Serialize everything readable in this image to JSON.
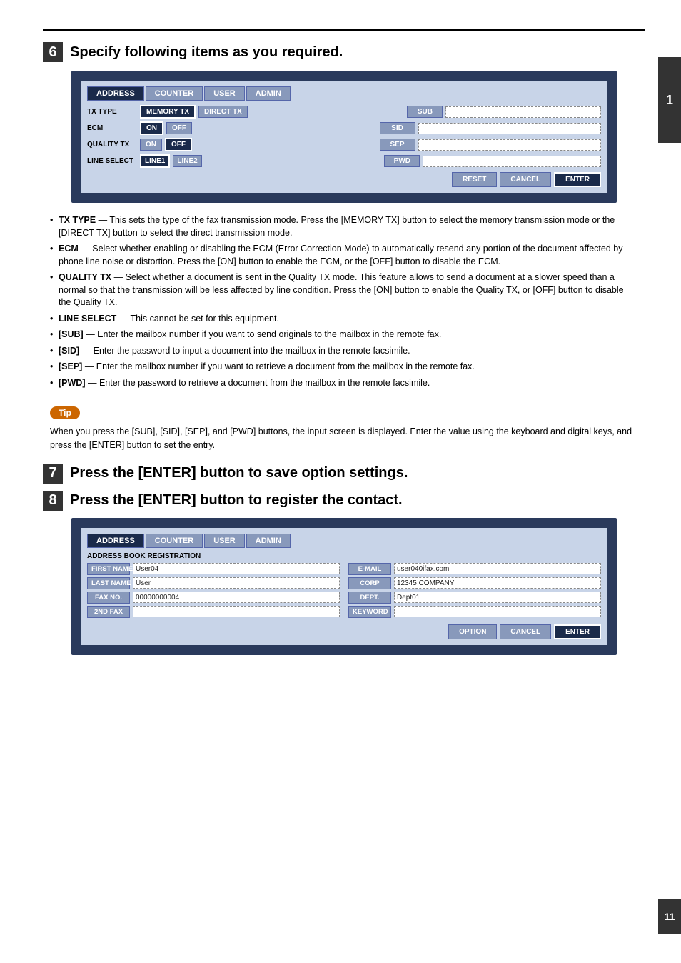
{
  "page": {
    "right_tab_1": "1",
    "right_tab_2": "11"
  },
  "step6": {
    "number": "6",
    "title": "Specify following items as you required.",
    "screen": {
      "tabs": [
        "ADDRESS",
        "COUNTER",
        "USER",
        "ADMIN"
      ],
      "active_tab": "ADDRESS",
      "tx_type_label": "TX TYPE",
      "tx_type_btns": [
        "MEMORY TX",
        "DIRECT TX"
      ],
      "ecm_label": "ECM",
      "ecm_btns": [
        "ON",
        "OFF"
      ],
      "quality_label": "QUALITY TX",
      "quality_btns": [
        "ON",
        "OFF"
      ],
      "line_label": "LINE SELECT",
      "line_btns": [
        "LINE1",
        "LINE2"
      ],
      "right_btns": [
        "SUB",
        "SID",
        "SEP",
        "PWD"
      ],
      "action_btns": [
        "RESET",
        "CANCEL",
        "ENTER"
      ]
    },
    "bullets": [
      {
        "key": "TX TYPE",
        "text": "— This sets the type of the fax transmission mode.  Press the [MEMORY TX] button to select the memory transmission mode or the [DIRECT TX] button to select the direct transmission mode."
      },
      {
        "key": "ECM",
        "text": "— Select whether enabling or disabling the ECM (Error Correction Mode) to automatically resend any portion of the document affected by phone line noise or distortion.  Press the [ON] button to enable the ECM, or the [OFF] button to disable the ECM."
      },
      {
        "key": "QUALITY TX",
        "text": "— Select whether a document is sent in the Quality TX mode. This feature allows to send a document at a slower speed than a normal so that the transmission will be less affected by line condition.  Press the [ON] button to enable the Quality TX, or [OFF] button to disable the Quality TX."
      },
      {
        "key": "LINE SELECT",
        "text": "— This cannot be set for this equipment."
      },
      {
        "key": "[SUB]",
        "text": "— Enter the mailbox number if you want to send originals to the mailbox in the remote fax."
      },
      {
        "key": "[SID]",
        "text": "— Enter the password to input a document into the mailbox in the remote facsimile."
      },
      {
        "key": "[SEP]",
        "text": "— Enter the mailbox number if you want to retrieve a document from the mailbox in the remote fax."
      },
      {
        "key": "[PWD]",
        "text": "— Enter the password to retrieve a document from the mailbox in the remote facsimile."
      }
    ],
    "tip_label": "Tip",
    "tip_text": "When you press the [SUB], [SID], [SEP], and [PWD] buttons, the input screen is displayed.  Enter the value using the keyboard and digital keys, and press the [ENTER] button to set the entry."
  },
  "step7": {
    "number": "7",
    "title": "Press the [ENTER] button to save option settings."
  },
  "step8": {
    "number": "8",
    "title": "Press the [ENTER] button to register the contact.",
    "screen": {
      "tabs": [
        "ADDRESS",
        "COUNTER",
        "USER",
        "ADMIN"
      ],
      "active_tab": "ADDRESS",
      "title": "ADDRESS BOOK REGISTRATION",
      "fields_left": [
        {
          "label": "FIRST NAME",
          "value": "User04"
        },
        {
          "label": "LAST NAME",
          "value": "User"
        },
        {
          "label": "FAX NO.",
          "value": "00000000004"
        },
        {
          "label": "2ND FAX",
          "value": ""
        }
      ],
      "fields_right": [
        {
          "label": "E-MAIL",
          "value": "user040ifax.com"
        },
        {
          "label": "CORP",
          "value": "12345 COMPANY"
        },
        {
          "label": "DEPT.",
          "value": "Dept01"
        },
        {
          "label": "KEYWORD",
          "value": ""
        }
      ],
      "action_btns": [
        "OPTION",
        "CANCEL",
        "ENTER"
      ]
    }
  }
}
